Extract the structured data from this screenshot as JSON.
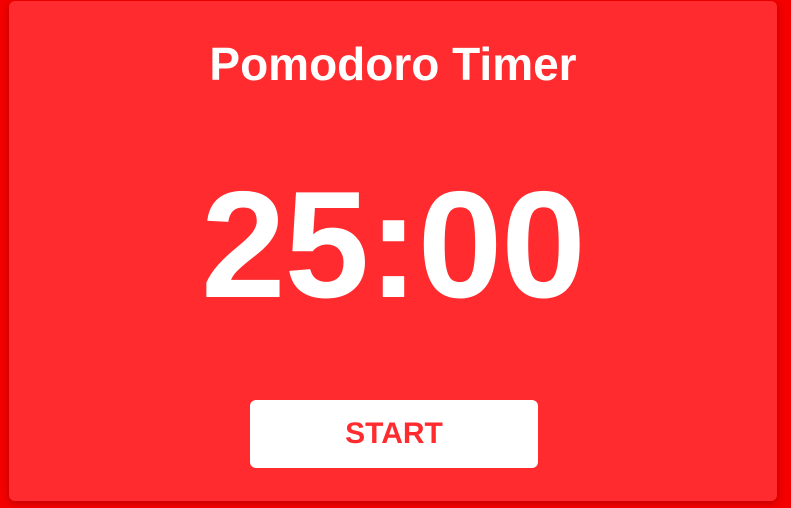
{
  "app": {
    "title": "Pomodoro Timer"
  },
  "timer": {
    "display": "25:00"
  },
  "controls": {
    "start_label": "START"
  },
  "colors": {
    "page_background": "#f40000",
    "card_background": "#ff2b2e",
    "text": "#ffffff",
    "button_background": "#ffffff",
    "button_text": "#ff2b2e"
  }
}
